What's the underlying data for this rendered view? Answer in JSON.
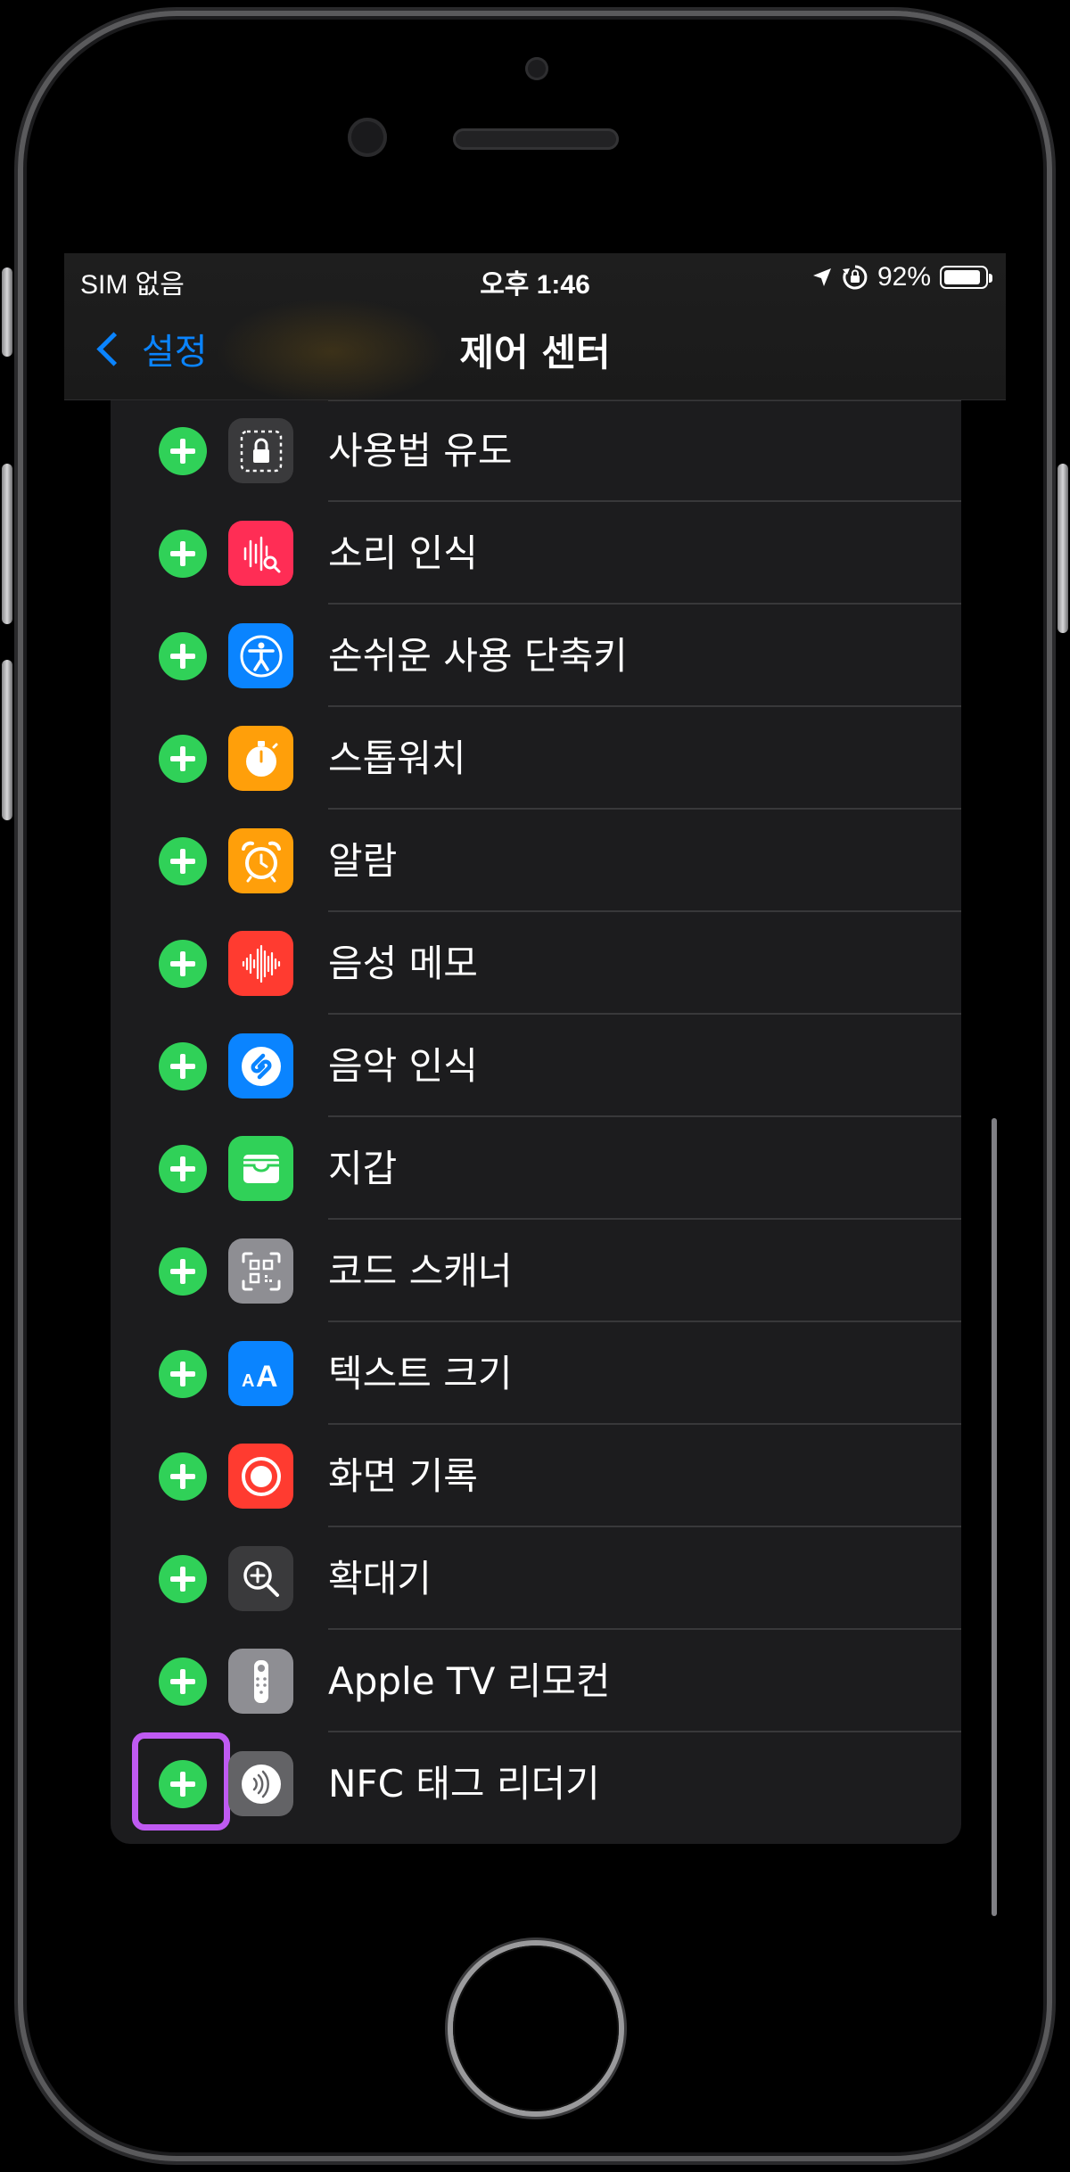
{
  "status_bar": {
    "carrier": "SIM 없음",
    "time": "오후 1:46",
    "battery_percent": "92%",
    "battery_level": 0.92,
    "icons": [
      "location-arrow-icon",
      "orientation-lock-icon",
      "battery-icon"
    ]
  },
  "nav": {
    "back_label": "설정",
    "title": "제어 센터"
  },
  "colors": {
    "add_button": "#30d158",
    "highlight": "#bf5af2",
    "link": "#0a84ff"
  },
  "controls": [
    {
      "label": "사용법 유도",
      "icon": "guided-access-lock-icon",
      "color": "#3a3a3c"
    },
    {
      "label": "소리 인식",
      "icon": "sound-recognition-icon",
      "color": "#ff2d55"
    },
    {
      "label": "손쉬운 사용 단축키",
      "icon": "accessibility-icon",
      "color": "#0a84ff"
    },
    {
      "label": "스톱워치",
      "icon": "stopwatch-icon",
      "color": "#ff9f0a"
    },
    {
      "label": "알람",
      "icon": "alarm-clock-icon",
      "color": "#ff9f0a"
    },
    {
      "label": "음성 메모",
      "icon": "voice-memo-waveform-icon",
      "color": "#ff3b30"
    },
    {
      "label": "음악 인식",
      "icon": "shazam-icon",
      "color": "#0a84ff"
    },
    {
      "label": "지갑",
      "icon": "wallet-icon",
      "color": "#30d158"
    },
    {
      "label": "코드 스캐너",
      "icon": "qr-code-scanner-icon",
      "color": "#8e8e93"
    },
    {
      "label": "텍스트 크기",
      "icon": "text-size-icon",
      "color": "#0a84ff"
    },
    {
      "label": "화면 기록",
      "icon": "screen-recording-icon",
      "color": "#ff3b30"
    },
    {
      "label": "확대기",
      "icon": "magnifier-icon",
      "color": "#3a3a3c"
    },
    {
      "label": "Apple TV 리모컨",
      "icon": "apple-tv-remote-icon",
      "color": "#8e8e93"
    },
    {
      "label": "NFC 태그 리더기",
      "icon": "nfc-tag-reader-icon",
      "color": "#636366",
      "highlighted": true
    }
  ]
}
